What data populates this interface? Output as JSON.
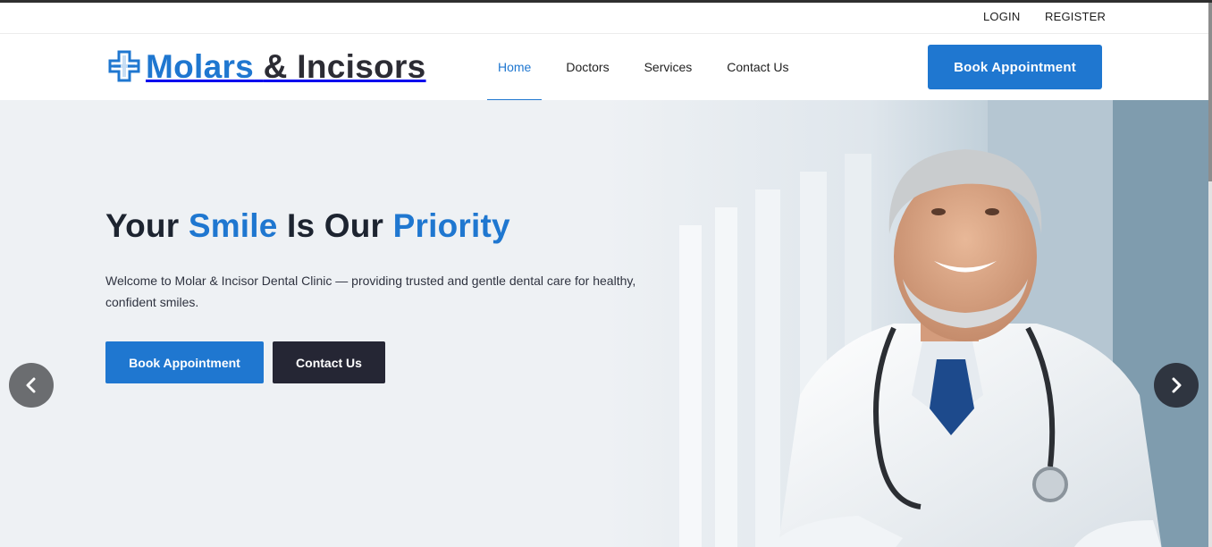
{
  "topbar": {
    "login_label": "LOGIN",
    "register_label": "REGISTER"
  },
  "brand": {
    "name_part1": "Molars",
    "name_part2": "& Incisors",
    "icon": "medical-cross-icon",
    "accent_color": "#1f77d0",
    "dark_color": "#2c2c34"
  },
  "nav": {
    "items": [
      {
        "label": "Home",
        "active": true
      },
      {
        "label": "Doctors",
        "active": false
      },
      {
        "label": "Services",
        "active": false
      },
      {
        "label": "Contact Us",
        "active": false
      }
    ],
    "book_button_label": "Book Appointment"
  },
  "hero": {
    "title_part1": "Your",
    "title_accent1": "Smile",
    "title_part2": "Is Our",
    "title_accent2": "Priority",
    "description": "Welcome to Molar & Incisor Dental Clinic — providing trusted and gentle dental care for healthy, confident smiles.",
    "primary_button_label": "Book Appointment",
    "secondary_button_label": "Contact Us",
    "prev_icon": "chevron-left-icon",
    "next_icon": "chevron-right-icon",
    "image": "smiling-doctor-with-stethoscope"
  },
  "colors": {
    "primary": "#1f77d0",
    "dark_button": "#252634",
    "hero_background": "#eef1f4"
  }
}
